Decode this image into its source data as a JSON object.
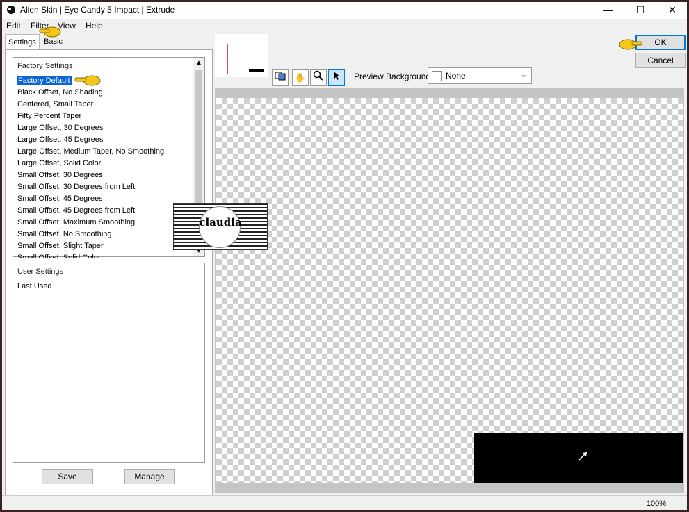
{
  "window": {
    "title": "Alien Skin | Eye Candy 5 Impact | Extrude",
    "minimize_glyph": "—",
    "maximize_glyph": "☐",
    "close_glyph": "✕"
  },
  "menu": [
    "Edit",
    "Filter",
    "View",
    "Help"
  ],
  "tabs": [
    "Settings",
    "Basic"
  ],
  "factory": {
    "header": "Factory Settings",
    "items": [
      "Factory Default",
      "Black Offset, No Shading",
      "Centered, Small Taper",
      "Fifty Percent Taper",
      "Large Offset, 30 Degrees",
      "Large Offset, 45 Degrees",
      "Large Offset, Medium Taper, No Smoothing",
      "Large Offset, Solid Color",
      "Small Offset, 30 Degrees",
      "Small Offset, 30 Degrees from Left",
      "Small Offset, 45 Degrees",
      "Small Offset, 45 Degrees from Left",
      "Small Offset, Maximum Smoothing",
      "Small Offset, No Smoothing",
      "Small Offset, Slight Taper",
      "Small Offset, Solid Color"
    ],
    "selected_index": 0
  },
  "user": {
    "header": "User Settings",
    "items": [
      "Last Used"
    ]
  },
  "buttons": {
    "save": "Save",
    "manage": "Manage",
    "ok": "OK",
    "cancel": "Cancel"
  },
  "preview_background": {
    "label": "Preview Background:",
    "value": "None"
  },
  "status": {
    "zoom": "100%"
  },
  "watermark": "claudia",
  "icons": [
    "preview-toggle-icon",
    "hand-icon",
    "zoom-icon",
    "arrow-pointer-icon"
  ],
  "colors": {
    "selection": "#0a64d6",
    "pointer_hand": "#f5c518"
  }
}
